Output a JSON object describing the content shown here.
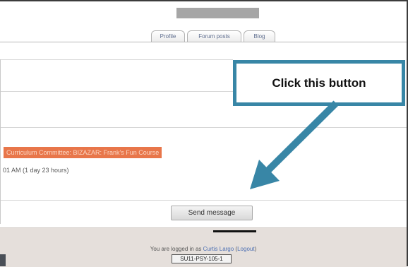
{
  "profile_tabs": [
    "Profile",
    "Forum posts",
    "Blog"
  ],
  "course_link": "Curriculum Committee: BIZAZAR: Frank's Fun Course",
  "last_access": "01 AM  (1 day 23 hours)",
  "send_message_label": "Send message",
  "footer": {
    "logged_in_prefix": "You are logged in as ",
    "user_name": "Curtis Largo",
    "logout_label": "Logout",
    "course_button": "SU11-PSY-105-1"
  },
  "callout": {
    "text": "Click this button",
    "color": "#3886a6"
  }
}
